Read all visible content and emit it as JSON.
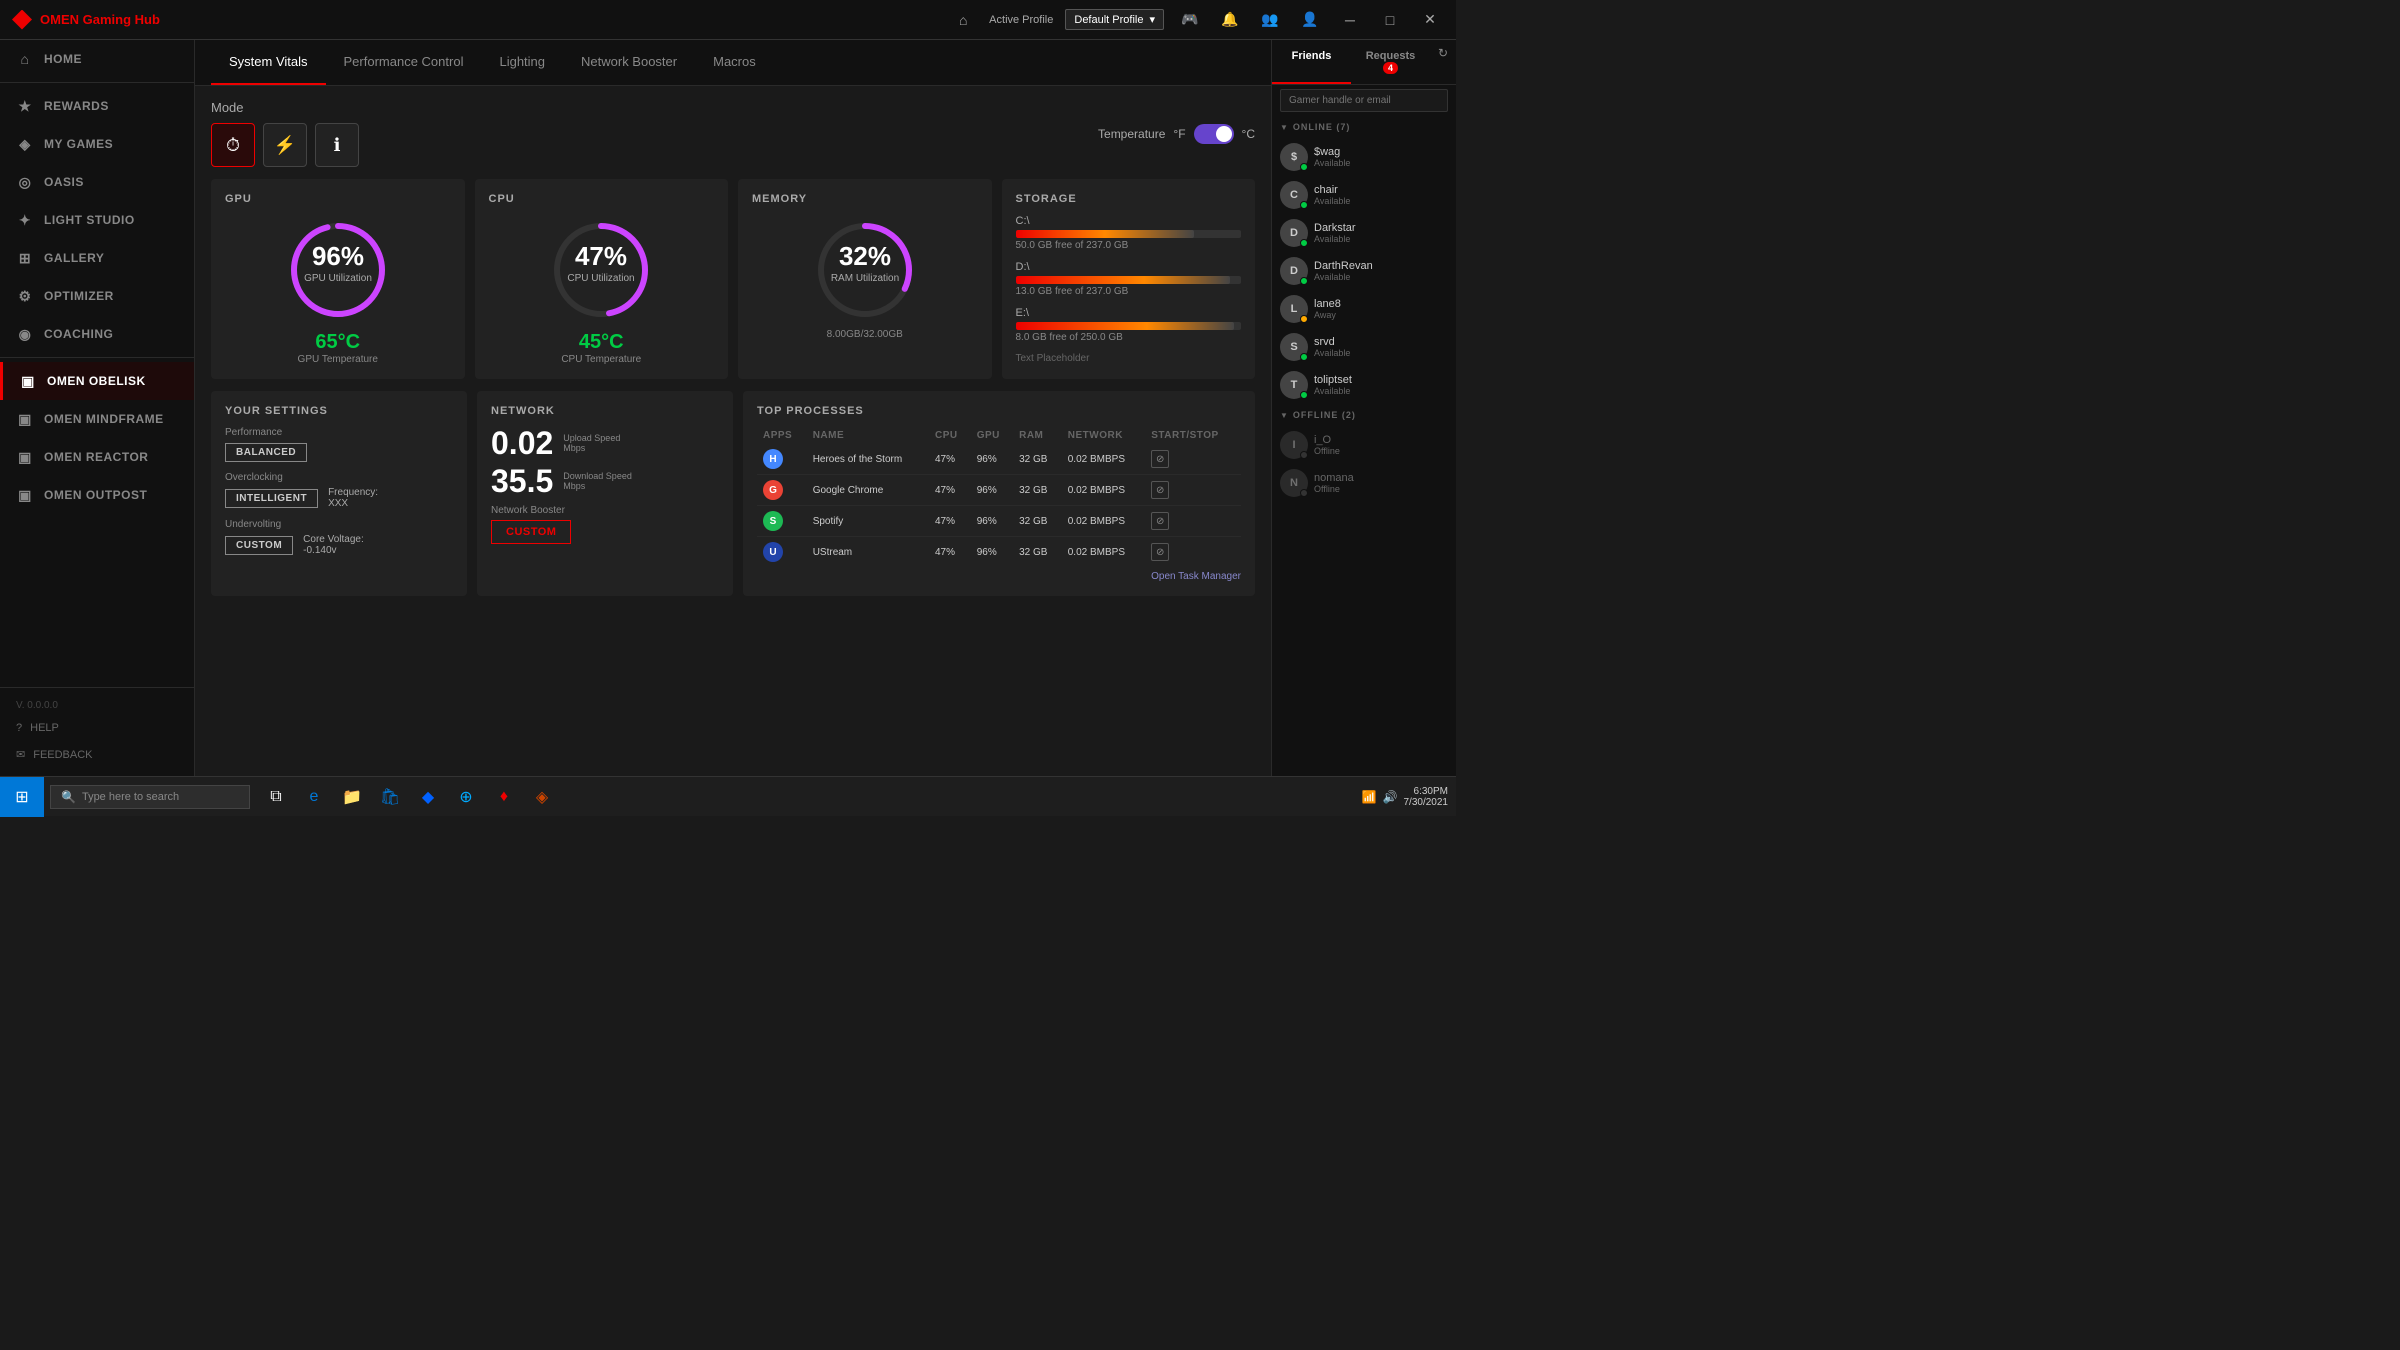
{
  "app": {
    "title": "OMEN Gaming Hub",
    "logo": "♦"
  },
  "topbar": {
    "home_icon": "⌂",
    "active_profile_label": "Active Profile",
    "profile_value": "Default Profile",
    "controller_icon": "🎮",
    "bell_icon": "🔔",
    "people_icon": "👥",
    "user_icon": "👤",
    "minimize_icon": "─",
    "maximize_icon": "□",
    "close_icon": "✕"
  },
  "sidebar": {
    "items": [
      {
        "id": "home",
        "label": "HOME",
        "icon": "⌂"
      },
      {
        "id": "rewards",
        "label": "REWARDS",
        "icon": "★"
      },
      {
        "id": "my-games",
        "label": "MY GAMES",
        "icon": "◈"
      },
      {
        "id": "oasis",
        "label": "OASIS",
        "icon": "◎"
      },
      {
        "id": "light-studio",
        "label": "LIGHT STUDIO",
        "icon": "✦"
      },
      {
        "id": "gallery",
        "label": "GALLERY",
        "icon": "⊞"
      },
      {
        "id": "optimizer",
        "label": "OPTIMIZER",
        "icon": "⚙"
      },
      {
        "id": "coaching",
        "label": "COACHING",
        "icon": "◉"
      },
      {
        "id": "omen-obelisk",
        "label": "OMEN OBELISK",
        "icon": "▣"
      },
      {
        "id": "omen-mindframe",
        "label": "OMEN MINDFRAME",
        "icon": "▣"
      },
      {
        "id": "omen-reactor",
        "label": "OMEN REACTOR",
        "icon": "▣"
      },
      {
        "id": "omen-outpost",
        "label": "OMEN OUTPOST",
        "icon": "▣"
      }
    ],
    "version": "V. 0.0.0.0",
    "help_label": "HELP",
    "feedback_label": "FEEDBACK"
  },
  "tabs": [
    {
      "id": "system-vitals",
      "label": "System Vitals",
      "active": true
    },
    {
      "id": "performance-control",
      "label": "Performance Control"
    },
    {
      "id": "lighting",
      "label": "Lighting"
    },
    {
      "id": "network-booster",
      "label": "Network Booster"
    },
    {
      "id": "macros",
      "label": "Macros"
    }
  ],
  "mode": {
    "label": "Mode",
    "icons": [
      "⏱",
      "⚡",
      "ℹ"
    ]
  },
  "temperature": {
    "label": "Temperature",
    "unit_f": "°F",
    "unit_c": "°C"
  },
  "gpu": {
    "title": "GPU",
    "percent": "96%",
    "util_label": "GPU Utilization",
    "temp_value": "65°C",
    "temp_label": "GPU Temperature",
    "gauge_color": "#cc44ff",
    "gauge_value": 96
  },
  "cpu": {
    "title": "CPU",
    "percent": "47%",
    "util_label": "CPU Utilization",
    "temp_value": "45°C",
    "temp_label": "CPU Temperature",
    "gauge_color": "#cc44ff",
    "gauge_value": 47
  },
  "memory": {
    "title": "MEMORY",
    "percent": "32%",
    "util_label": "RAM Utilization",
    "used": "8.00GB/32.00GB",
    "gauge_color": "#cc44ff",
    "gauge_value": 32
  },
  "storage": {
    "title": "STORAGE",
    "placeholder": "Text Placeholder",
    "drives": [
      {
        "label": "C:\\",
        "free": "50.0 GB free of 237.0 GB",
        "fill_pct": 79,
        "color_start": "#e00",
        "color_mid": "#ff8800",
        "color_end": "#444"
      },
      {
        "label": "D:\\",
        "free": "13.0 GB free of 237.0 GB",
        "fill_pct": 95,
        "color_start": "#e00",
        "color_mid": "#ff8800",
        "color_end": "#444"
      },
      {
        "label": "E:\\",
        "free": "8.0 GB free of 250.0 GB",
        "fill_pct": 97,
        "color_start": "#e00",
        "color_mid": "#ff8800",
        "color_end": "#444"
      }
    ]
  },
  "your_settings": {
    "title": "YOUR SETTINGS",
    "performance_label": "Performance",
    "performance_value": "BALANCED",
    "overclocking_label": "Overclocking",
    "overclocking_value": "INTELLIGENT",
    "frequency_label": "Frequency:",
    "frequency_value": "XXX",
    "undervolting_label": "Undervolting",
    "undervolting_value": "CUSTOM",
    "core_voltage_label": "Core Voltage:",
    "core_voltage_value": "-0.140v"
  },
  "network": {
    "title": "NETWORK",
    "upload_value": "0.02",
    "upload_label": "Upload Speed",
    "upload_unit": "Mbps",
    "download_value": "35.5",
    "download_label": "Download Speed",
    "download_unit": "Mbps",
    "booster_label": "Network Booster",
    "booster_btn": "CUSTOM"
  },
  "top_processes": {
    "title": "TOP PROCESSES",
    "columns": [
      "APPS",
      "NAME",
      "CPU",
      "GPU",
      "RAM",
      "NETWORK",
      "START/STOP"
    ],
    "rows": [
      {
        "name": "Heroes of the Storm",
        "cpu": "47%",
        "gpu": "96%",
        "ram": "32 GB",
        "network": "0.02 BMBPS",
        "icon_class": "app-icon-hots",
        "icon_letter": "H"
      },
      {
        "name": "Google Chrome",
        "cpu": "47%",
        "gpu": "96%",
        "ram": "32 GB",
        "network": "0.02 BMBPS",
        "icon_class": "app-icon-chrome",
        "icon_letter": "G"
      },
      {
        "name": "Spotify",
        "cpu": "47%",
        "gpu": "96%",
        "ram": "32 GB",
        "network": "0.02 BMBPS",
        "icon_class": "app-icon-spotify",
        "icon_letter": "S"
      },
      {
        "name": "UStream",
        "cpu": "47%",
        "gpu": "96%",
        "ram": "32 GB",
        "network": "0.02 BMBPS",
        "icon_class": "app-icon-ustream",
        "icon_letter": "U"
      }
    ],
    "open_task_manager": "Open Task Manager"
  },
  "friends": {
    "tab_friends": "Friends",
    "tab_requests": "Requests",
    "requests_count": "4",
    "search_placeholder": "Gamer handle or email",
    "online_header": "ONLINE (7)",
    "offline_header": "OFFLINE (2)",
    "online_friends": [
      {
        "name": "$wag",
        "status": "Available",
        "dot": "online",
        "initial": "$"
      },
      {
        "name": "chair",
        "status": "Available",
        "dot": "online",
        "initial": "C"
      },
      {
        "name": "Darkstar",
        "status": "Available",
        "dot": "online",
        "initial": "D"
      },
      {
        "name": "DarthRevan",
        "status": "Available",
        "dot": "online",
        "initial": "D"
      },
      {
        "name": "lane8",
        "status": "Away",
        "dot": "away",
        "initial": "L"
      },
      {
        "name": "srvd",
        "status": "Available",
        "dot": "online",
        "initial": "S"
      },
      {
        "name": "toliptset",
        "status": "Available",
        "dot": "online",
        "initial": "T"
      }
    ],
    "offline_friends": [
      {
        "name": "i_O",
        "status": "Offline",
        "dot": "offline",
        "initial": "I"
      },
      {
        "name": "nomana",
        "status": "Offline",
        "dot": "offline",
        "initial": "N"
      }
    ]
  },
  "taskbar": {
    "search_placeholder": "Type here to search",
    "time": "6:30PM",
    "date": "7/30/2021"
  }
}
